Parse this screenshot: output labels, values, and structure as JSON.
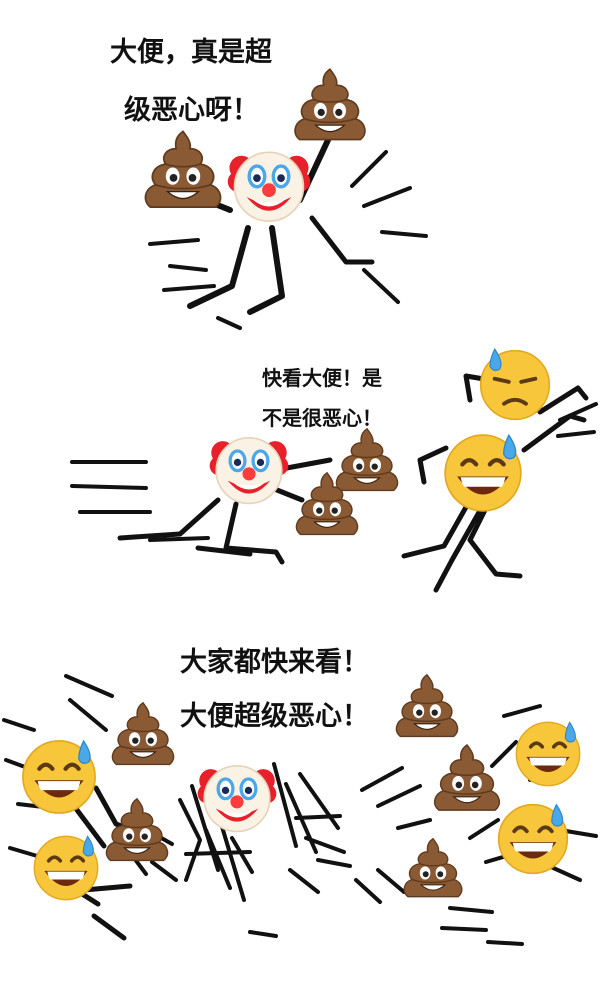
{
  "panels": [
    {
      "captions": [
        "大便，真是超",
        "级恶心呀！"
      ]
    },
    {
      "captions": [
        "快看大便！是",
        "不是很恶心！"
      ]
    },
    {
      "captions": [
        "大家都快来看！",
        "大便超级恶心！"
      ]
    }
  ],
  "icons": {
    "clown": "clown-face-icon",
    "poop": "pile-of-poo-icon",
    "sweat": "grinning-face-with-sweat-icon",
    "downcast": "downcast-face-with-sweat-icon"
  },
  "colors": {
    "ink": "#111111",
    "poop_brown": "#8a5a34",
    "poop_dark": "#5e3a1e",
    "emoji_yellow": "#f8c63a",
    "clown_red": "#e8202a",
    "clown_nose": "#ff3b3b",
    "sweat_blue": "#4aa7e8"
  }
}
